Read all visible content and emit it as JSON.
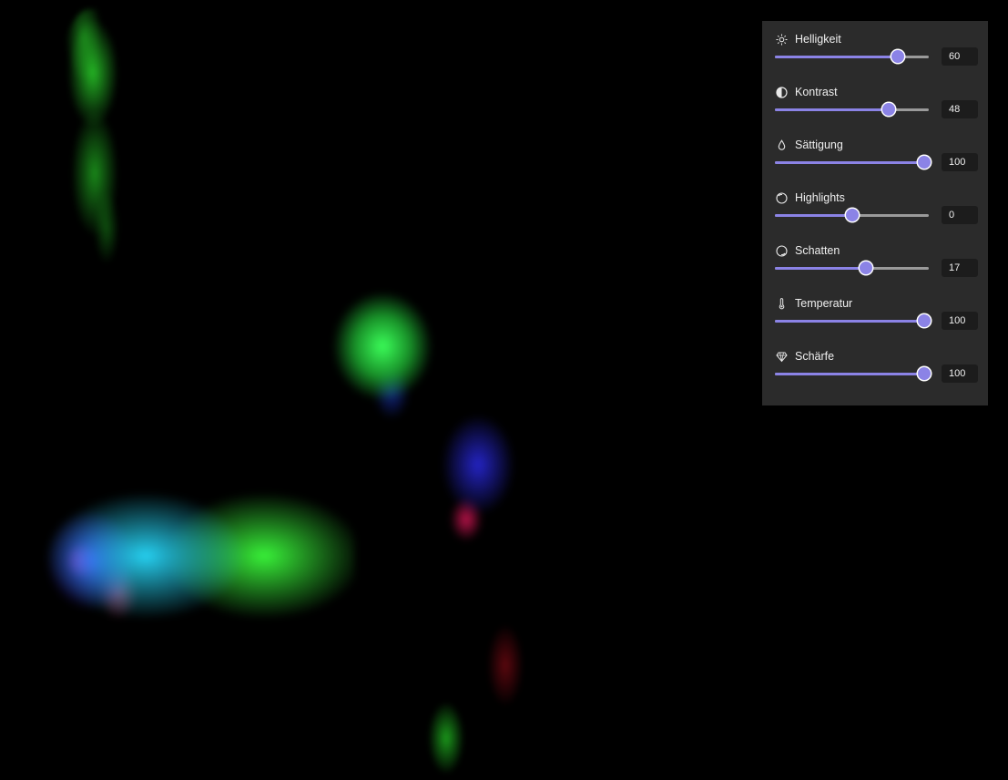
{
  "image": {
    "description_color": "#000000"
  },
  "panel": {
    "background": "#2b2b2b",
    "accent": "#8b83e6",
    "adjustments": [
      {
        "label": "Helligkeit",
        "icon": "sun-icon",
        "value": "60",
        "level": 0.8
      },
      {
        "label": "Kontrast",
        "icon": "contrast-icon",
        "value": "48",
        "level": 0.74
      },
      {
        "label": "Sättigung",
        "icon": "drop-icon",
        "value": "100",
        "level": 0.97
      },
      {
        "label": "Highlights",
        "icon": "highlights-icon",
        "value": "0",
        "level": 0.5
      },
      {
        "label": "Schatten",
        "icon": "shadows-icon",
        "value": "17",
        "level": 0.59
      },
      {
        "label": "Temperatur",
        "icon": "thermometer-icon",
        "value": "100",
        "level": 0.97
      },
      {
        "label": "Schärfe",
        "icon": "diamond-icon",
        "value": "100",
        "level": 0.97
      }
    ]
  }
}
